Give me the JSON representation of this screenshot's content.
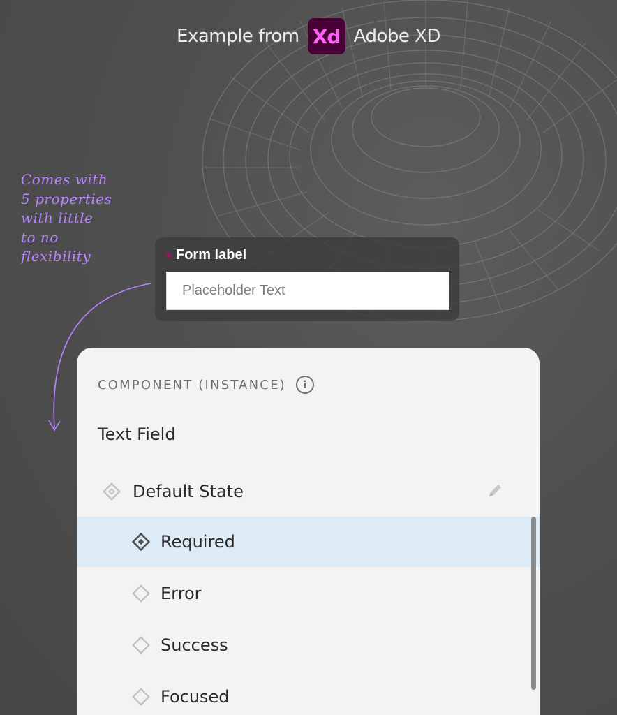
{
  "header": {
    "prefix": "Example from",
    "logo_text": "Xd",
    "brand": "Adobe XD"
  },
  "annotation": {
    "lines": [
      "Comes with",
      "5 properties",
      "with little",
      "to no",
      "flexibility"
    ]
  },
  "form_preview": {
    "label": "Form label",
    "placeholder": "Placeholder Text"
  },
  "panel": {
    "section_title": "COMPONENT (INSTANCE)",
    "info_icon": "i",
    "component_name": "Text Field",
    "default_state": "Default State",
    "states": [
      {
        "label": "Required",
        "selected": true
      },
      {
        "label": "Error",
        "selected": false
      },
      {
        "label": "Success",
        "selected": false
      },
      {
        "label": "Focused",
        "selected": false
      }
    ]
  },
  "colors": {
    "background": "#4f4f4f",
    "xd_logo_bg": "#470137",
    "xd_logo_fg": "#ff61f6",
    "annotation": "#b784ff",
    "selected_row": "#ddebf7",
    "required_dot": "#8a1c5c"
  },
  "icons": {
    "info": "info-circle-icon",
    "state": "diamond-state-icon",
    "edit": "pencil-icon"
  }
}
